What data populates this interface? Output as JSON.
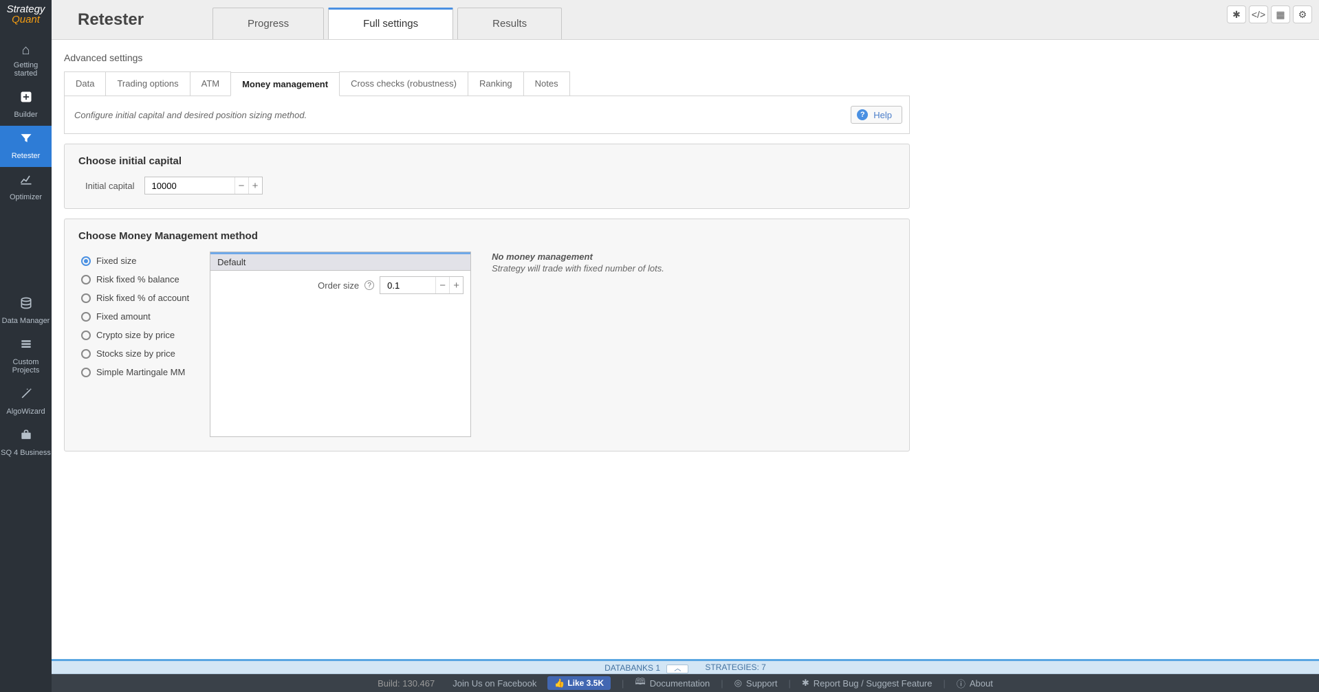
{
  "app": {
    "name1": "Strategy",
    "name2": "Quant"
  },
  "top_buttons": [
    "bug",
    "code",
    "grid",
    "gear"
  ],
  "sidebar": {
    "items": [
      {
        "label": "Getting\nstarted",
        "icon": "home"
      },
      {
        "label": "Builder",
        "icon": "plus"
      },
      {
        "label": "Retester",
        "icon": "filter",
        "active": true
      },
      {
        "label": "Optimizer",
        "icon": "chart"
      }
    ],
    "items2": [
      {
        "label": "Data Manager",
        "icon": "db"
      },
      {
        "label": "Custom\nProjects",
        "icon": "stack"
      },
      {
        "label": "AlgoWizard",
        "icon": "wand"
      },
      {
        "label": "SQ 4 Business",
        "icon": "case"
      }
    ]
  },
  "page_title": "Retester",
  "main_tabs": [
    {
      "label": "Progress"
    },
    {
      "label": "Full settings",
      "active": true
    },
    {
      "label": "Results"
    }
  ],
  "breadcrumb": "Advanced settings",
  "sub_tabs": [
    {
      "label": "Data"
    },
    {
      "label": "Trading options"
    },
    {
      "label": "ATM"
    },
    {
      "label": "Money management",
      "active": true
    },
    {
      "label": "Cross checks (robustness)"
    },
    {
      "label": "Ranking"
    },
    {
      "label": "Notes"
    }
  ],
  "help": {
    "description": "Configure initial capital and desired position sizing method.",
    "button": "Help"
  },
  "capital_section": {
    "title": "Choose initial capital",
    "field_label": "Initial capital",
    "value": "10000"
  },
  "mm_section": {
    "title": "Choose Money Management method",
    "options": [
      "Fixed size",
      "Risk fixed % balance",
      "Risk fixed % of account",
      "Fixed amount",
      "Crypto size by price",
      "Stocks size by price",
      "Simple Martingale MM"
    ],
    "selected_index": 0,
    "default_box": {
      "header": "Default",
      "order_size_label": "Order size",
      "order_size_value": "0.1"
    },
    "info": {
      "title": "No money management",
      "desc": "Strategy will trade with fixed number of lots."
    }
  },
  "footer": {
    "databanks_label": "DATABANKS 1",
    "strategies_label": "STRATEGIES: 7",
    "build": "Build: 130.467",
    "join_fb": "Join Us on Facebook",
    "like": "Like 3.5K",
    "links": [
      "Documentation",
      "Support",
      "Report Bug / Suggest Feature",
      "About"
    ]
  }
}
